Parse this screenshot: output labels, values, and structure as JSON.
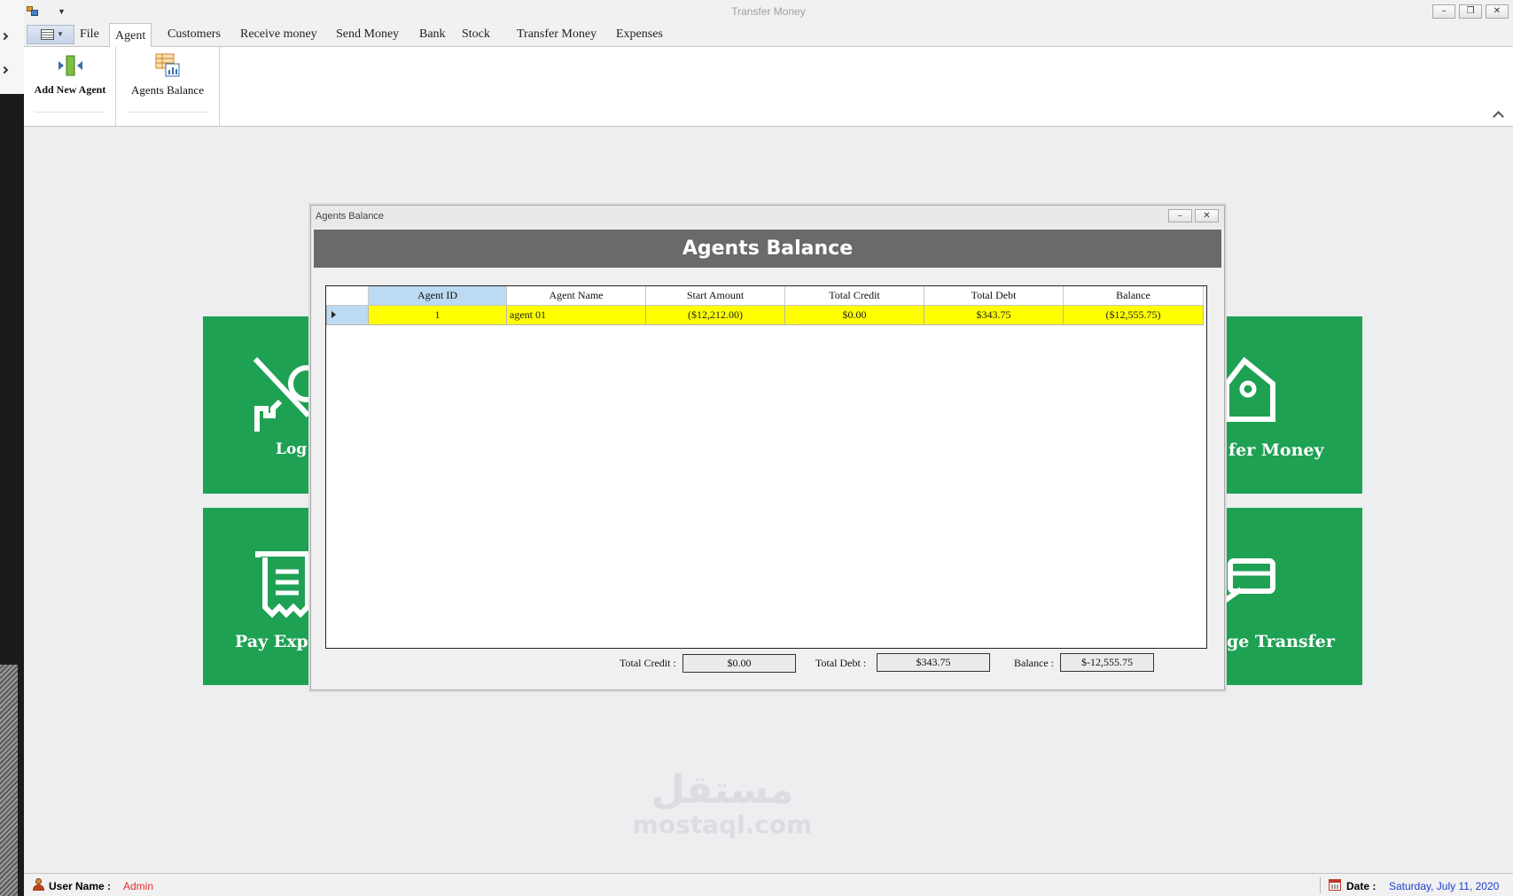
{
  "window": {
    "title": "Transfer Money"
  },
  "ribbon_tabs": [
    "File",
    "Agent",
    "Customers",
    "Receive money",
    "Send Money",
    "Bank",
    "Stock",
    "Transfer Money",
    "Expenses"
  ],
  "active_tab": "Agent",
  "ribbon": {
    "add_agent_label": "Add  New Agent",
    "agents_balance_label": "Agents Balance"
  },
  "tiles": {
    "login": "Log in",
    "transfer_money": "fer Money",
    "pay_expenses": "Pay Expe",
    "change_transfer": "ge Transfer"
  },
  "dialog": {
    "window_title": "Agents Balance",
    "header": "Agents Balance",
    "columns": [
      "Agent ID",
      "Agent Name",
      "Start Amount",
      "Total Credit",
      "Total Debt",
      "Balance"
    ],
    "rows": [
      {
        "agent_id": "1",
        "agent_name": "agent 01",
        "start_amount": "($12,212.00)",
        "total_credit": "$0.00",
        "total_debt": "$343.75",
        "balance": "($12,555.75)"
      }
    ],
    "totals": {
      "credit_label": "Total Credit :",
      "credit_value": "$0.00",
      "debt_label": "Total Debt :",
      "debt_value": "$343.75",
      "balance_label": "Balance :",
      "balance_value": "$-12,555.75"
    }
  },
  "watermark": {
    "arabic": "مستقل",
    "latin": "mostaql.com"
  },
  "status": {
    "user_label": "User Name :",
    "user_value": "Admin",
    "date_label": "Date :",
    "date_value": "Saturday, July 11, 2020"
  },
  "colors": {
    "tile_green": "#1fa154",
    "row_highlight": "#ffff00",
    "selected_header": "#bcdaf1",
    "dialog_header": "#6a6a6a",
    "user_value": "#e03030",
    "date_value": "#1a3fd0"
  }
}
